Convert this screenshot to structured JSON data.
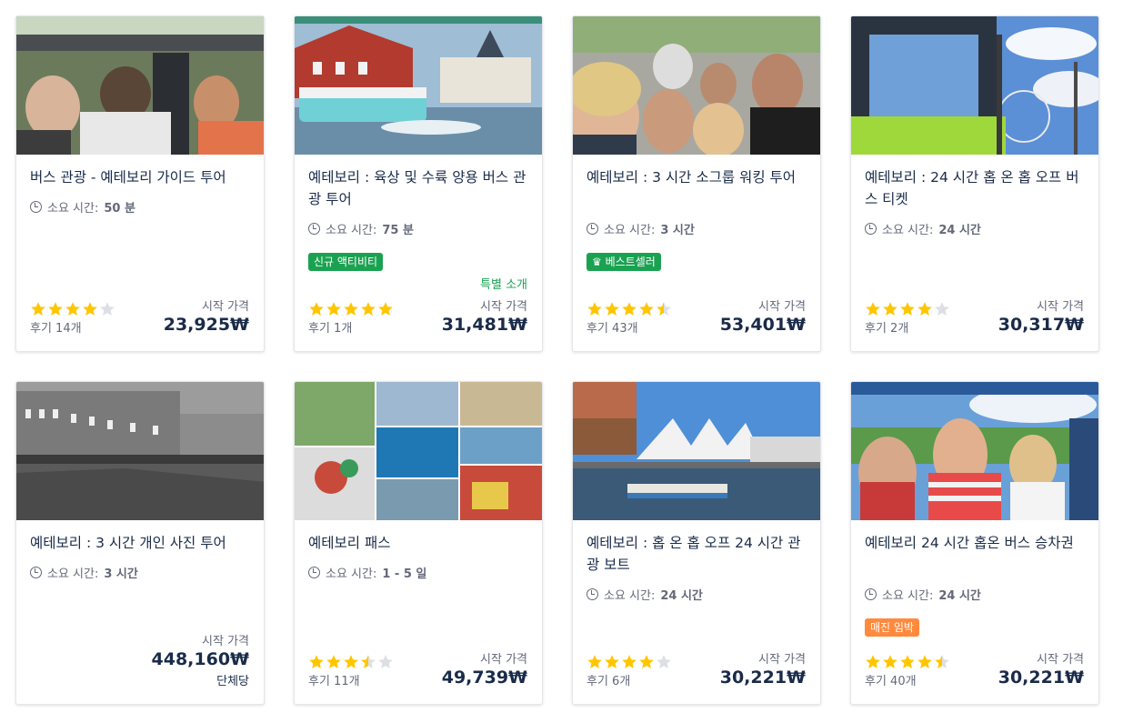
{
  "cards": [
    {
      "title": "버스 관광 - 예테보리 가이드 투어",
      "duration_label": "소요 시간:",
      "duration_value": "50 분",
      "rating": 4,
      "reviews": "후기 14개",
      "price_label": "시작 가격",
      "price": "23,925₩"
    },
    {
      "title": "예테보리 : 육상 및 수륙 양용 버스 관광 투어",
      "duration_label": "소요 시간:",
      "duration_value": "75 분",
      "badge": "신규 액티비티",
      "featured": "특별 소개",
      "rating": 5,
      "reviews": "후기 1개",
      "price_label": "시작 가격",
      "price": "31,481₩"
    },
    {
      "title": "예테보리 : 3 시간 소그룹 워킹 투어",
      "duration_label": "소요 시간:",
      "duration_value": "3 시간",
      "badge": "♛ 베스트셀러",
      "rating": 4.5,
      "reviews": "후기 43개",
      "price_label": "시작 가격",
      "price": "53,401₩"
    },
    {
      "title": "예테보리 : 24 시간 홉 온 홉 오프 버스 티켓",
      "duration_label": "소요 시간:",
      "duration_value": "24 시간",
      "rating": 4,
      "reviews": "후기 2개",
      "price_label": "시작 가격",
      "price": "30,317₩"
    },
    {
      "title": "예테보리 : 3 시간 개인 사진 투어",
      "duration_label": "소요 시간:",
      "duration_value": "3 시간",
      "price_label": "시작 가격",
      "price": "448,160₩",
      "unit": "단체당"
    },
    {
      "title": "예테보리 패스",
      "duration_label": "소요 시간:",
      "duration_value": "1 - 5 일",
      "rating": 3.5,
      "reviews": "후기 11개",
      "price_label": "시작 가격",
      "price": "49,739₩"
    },
    {
      "title": "예테보리 : 홉 온 홉 오프 24 시간 관광 보트",
      "duration_label": "소요 시간:",
      "duration_value": "24 시간",
      "rating": 4,
      "reviews": "후기 6개",
      "price_label": "시작 가격",
      "price": "30,221₩"
    },
    {
      "title": "예테보리 24 시간 홉온 버스 승차권",
      "duration_label": "소요 시간:",
      "duration_value": "24 시간",
      "badge": "매진 임박",
      "rating": 4.5,
      "reviews": "후기 40개",
      "price_label": "시작 가격",
      "price": "30,221₩"
    }
  ],
  "colors": {
    "star": "#ffc600",
    "star_empty": "#dcdfe4",
    "badge_green": "#1aa251",
    "badge_orange": "#ff8a3d",
    "text_dark": "#1a2b49",
    "text_muted": "#63687a"
  }
}
